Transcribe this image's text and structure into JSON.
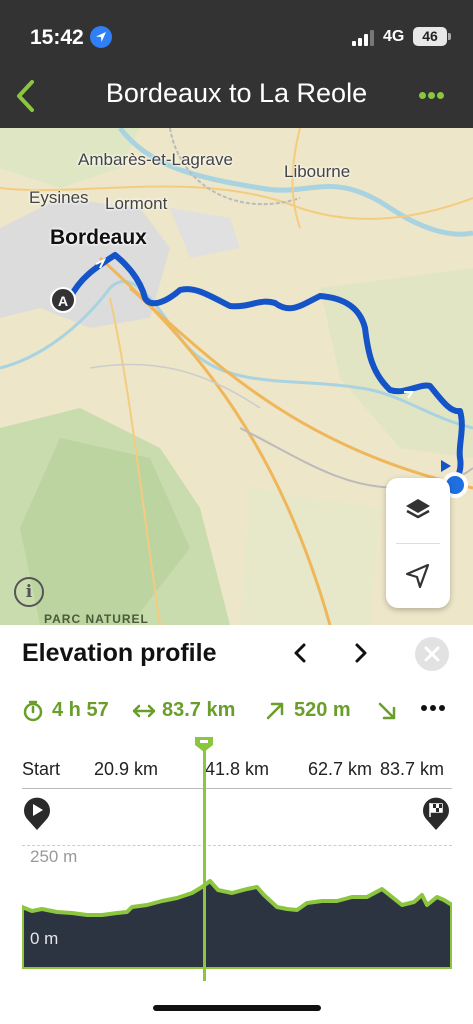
{
  "status": {
    "time": "15:42",
    "network": "4G",
    "battery": "46"
  },
  "header": {
    "title": "Bordeaux to La Reole"
  },
  "map": {
    "labels": {
      "ambares": "Ambarès-et-Lagrave",
      "libourne": "Libourne",
      "eysines": "Eysines",
      "lormont": "Lormont",
      "bordeaux": "Bordeaux",
      "park": "PARC NATUREL"
    },
    "start_marker": "A",
    "info_glyph": "i"
  },
  "sheet": {
    "title": "Elevation profile",
    "stats": {
      "duration": "4 h 57",
      "distance": "83.7 km",
      "ascent": "520 m"
    },
    "ticks": [
      "Start",
      "20.9 km",
      "41.8 km",
      "62.7 km",
      "83.7 km"
    ],
    "elevation_labels": {
      "top": "250 m",
      "bottom": "0 m"
    }
  },
  "colors": {
    "accent": "#8cc63f",
    "route": "#1454c8",
    "header_bg": "#333333",
    "profile_fill": "#2d3441"
  },
  "icons": {
    "back": "chevron-left-icon",
    "more": "more-horizontal-icon",
    "layers": "layers-icon",
    "locate": "navigation-arrow-icon",
    "close": "close-icon"
  }
}
